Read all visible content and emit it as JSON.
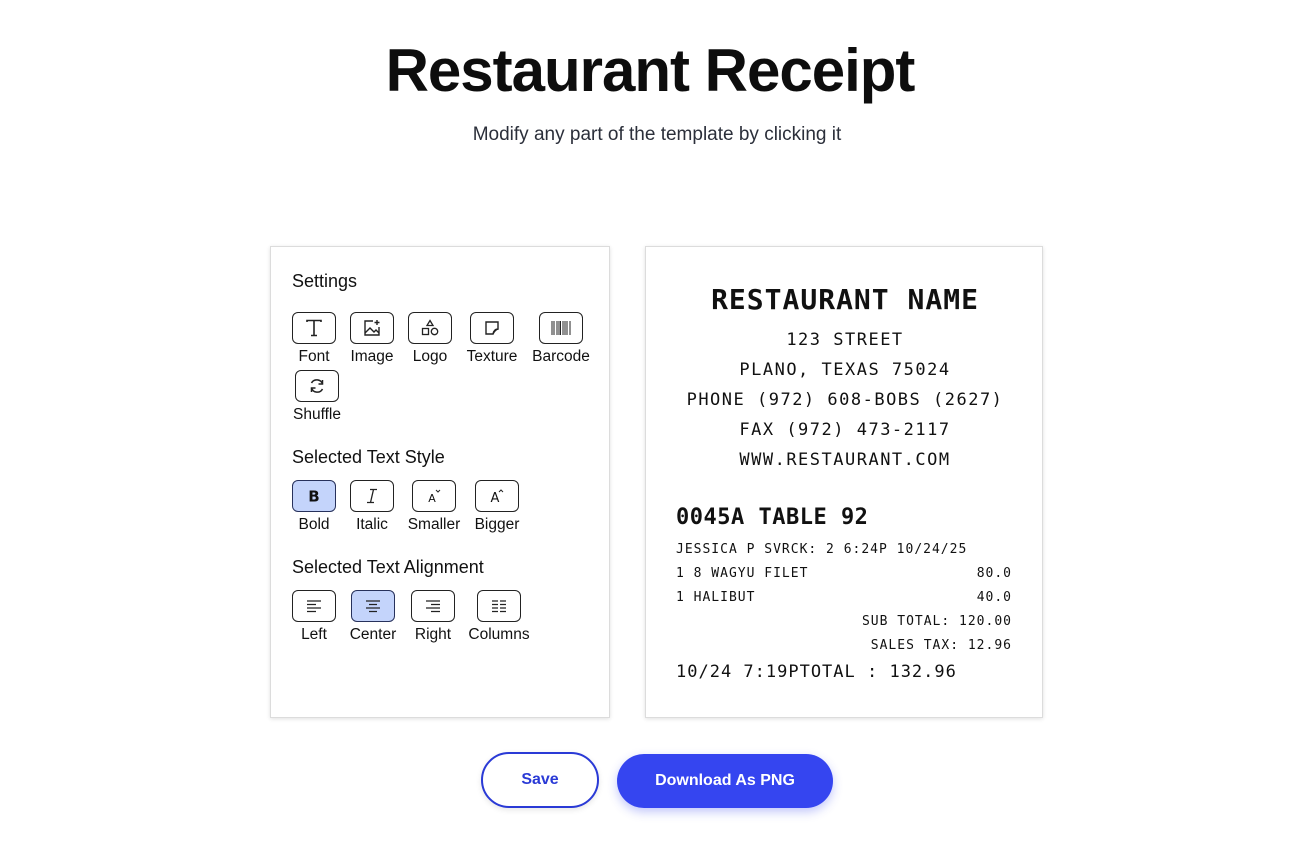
{
  "header": {
    "title": "Restaurant Receipt",
    "subtitle": "Modify any part of the template by clicking it"
  },
  "settings": {
    "title": "Settings",
    "tools": [
      {
        "label": "Font",
        "icon": "font-icon"
      },
      {
        "label": "Image",
        "icon": "image-add-icon"
      },
      {
        "label": "Logo",
        "icon": "shapes-icon"
      },
      {
        "label": "Texture",
        "icon": "texture-icon"
      },
      {
        "label": "Barcode",
        "icon": "barcode-icon"
      },
      {
        "label": "Shuffle",
        "icon": "refresh-icon"
      }
    ]
  },
  "text_style": {
    "title": "Selected Text Style",
    "tools": [
      {
        "label": "Bold",
        "icon": "bold-icon",
        "active": true
      },
      {
        "label": "Italic",
        "icon": "italic-icon",
        "active": false
      },
      {
        "label": "Smaller",
        "icon": "font-smaller-icon",
        "active": false
      },
      {
        "label": "Bigger",
        "icon": "font-bigger-icon",
        "active": false
      }
    ]
  },
  "text_alignment": {
    "title": "Selected Text Alignment",
    "tools": [
      {
        "label": "Left",
        "icon": "align-left-icon",
        "active": false
      },
      {
        "label": "Center",
        "icon": "align-center-icon",
        "active": true
      },
      {
        "label": "Right",
        "icon": "align-right-icon",
        "active": false
      },
      {
        "label": "Columns",
        "icon": "columns-icon",
        "active": false
      }
    ]
  },
  "receipt": {
    "name": "RESTAURANT NAME",
    "address_lines": [
      "123 STREET",
      "PLANO, TEXAS 75024",
      "PHONE (972) 608-BOBS (2627)",
      "FAX (972) 473-2117",
      "WWW.RESTAURANT.COM"
    ],
    "order_line": "0045A TABLE 92",
    "server_line": "JESSICA P SVRCK: 2 6:24P 10/24/25",
    "items": [
      {
        "name": "1 8 WAGYU FILET",
        "price": "80.0"
      },
      {
        "name": "1 HALIBUT",
        "price": "40.0"
      }
    ],
    "subtotal": "SUB TOTAL: 120.00",
    "sales_tax": "SALES TAX: 12.96",
    "total_line": "10/24 7:19PTOTAL : 132.96"
  },
  "actions": {
    "save_label": "Save",
    "download_label": "Download As PNG"
  },
  "colors": {
    "accent": "#3545f0",
    "active_tool_bg": "#c4d4fb"
  }
}
